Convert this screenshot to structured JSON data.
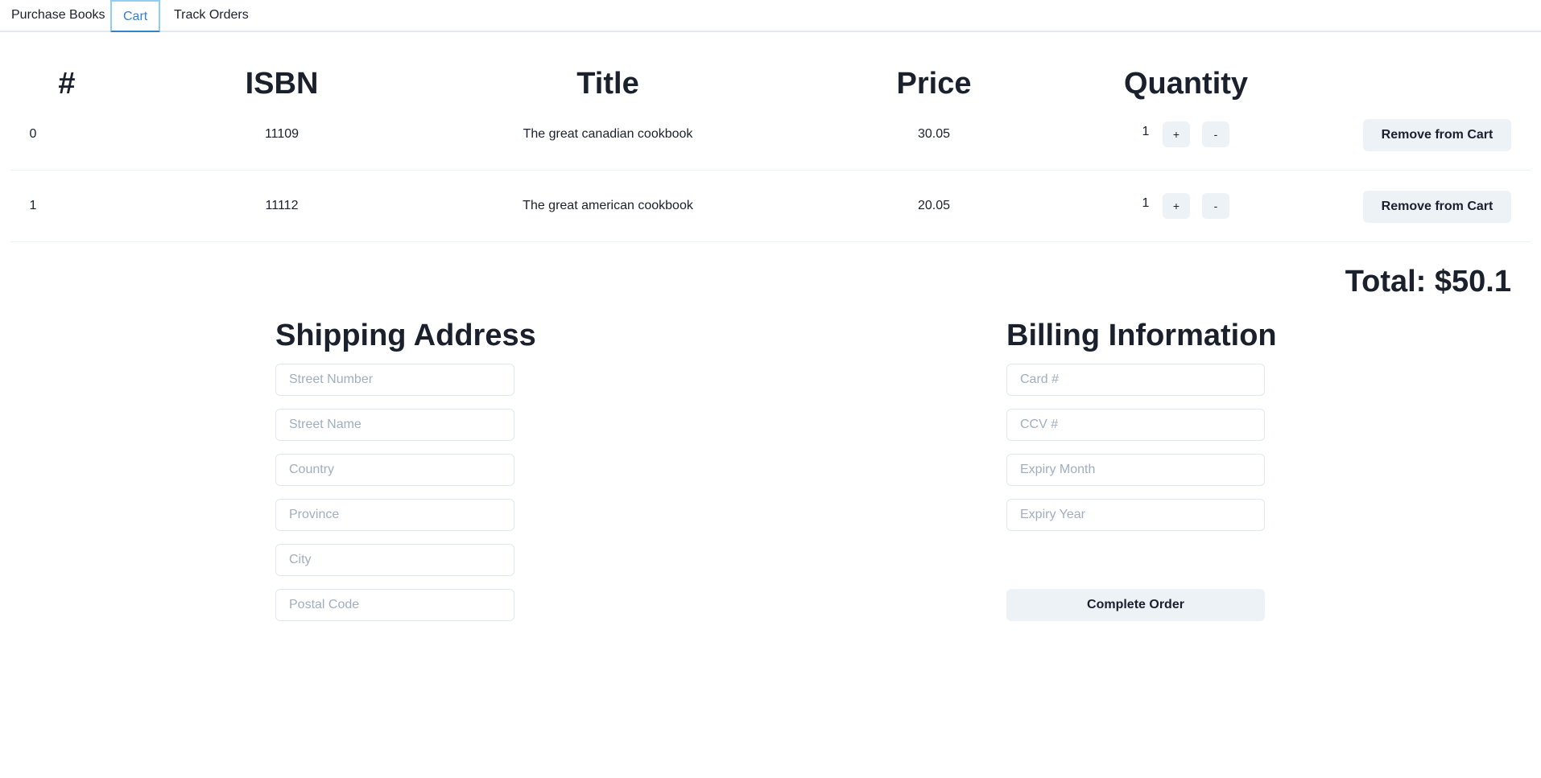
{
  "tabs": [
    {
      "label": "Purchase Books",
      "active": false
    },
    {
      "label": "Cart",
      "active": true
    },
    {
      "label": "Track Orders",
      "active": false
    }
  ],
  "cart": {
    "columns": [
      "#",
      "ISBN",
      "Title",
      "Price",
      "Quantity"
    ],
    "rows": [
      {
        "index": "0",
        "isbn": "11109",
        "title": "The great canadian cookbook",
        "price": "30.05",
        "quantity": "1",
        "plus": "+",
        "minus": "-",
        "remove_label": "Remove from Cart"
      },
      {
        "index": "1",
        "isbn": "11112",
        "title": "The great american cookbook",
        "price": "20.05",
        "quantity": "1",
        "plus": "+",
        "minus": "-",
        "remove_label": "Remove from Cart"
      }
    ],
    "total": "Total: $50.1"
  },
  "shipping": {
    "title": "Shipping Address",
    "fields": [
      {
        "placeholder": "Street Number",
        "value": ""
      },
      {
        "placeholder": "Street Name",
        "value": ""
      },
      {
        "placeholder": "Country",
        "value": ""
      },
      {
        "placeholder": "Province",
        "value": ""
      },
      {
        "placeholder": "City",
        "value": ""
      },
      {
        "placeholder": "Postal Code",
        "value": ""
      }
    ]
  },
  "billing": {
    "title": "Billing Information",
    "fields": [
      {
        "placeholder": "Card #",
        "value": ""
      },
      {
        "placeholder": "CCV #",
        "value": ""
      },
      {
        "placeholder": "Expiry Month",
        "value": ""
      },
      {
        "placeholder": "Expiry Year",
        "value": ""
      }
    ],
    "complete_label": "Complete Order"
  },
  "colors": {
    "accent": "#3182ce",
    "button_bg": "#edf2f7",
    "text": "#1a202c",
    "placeholder": "#a0aec0",
    "border": "#e2e8f0"
  }
}
